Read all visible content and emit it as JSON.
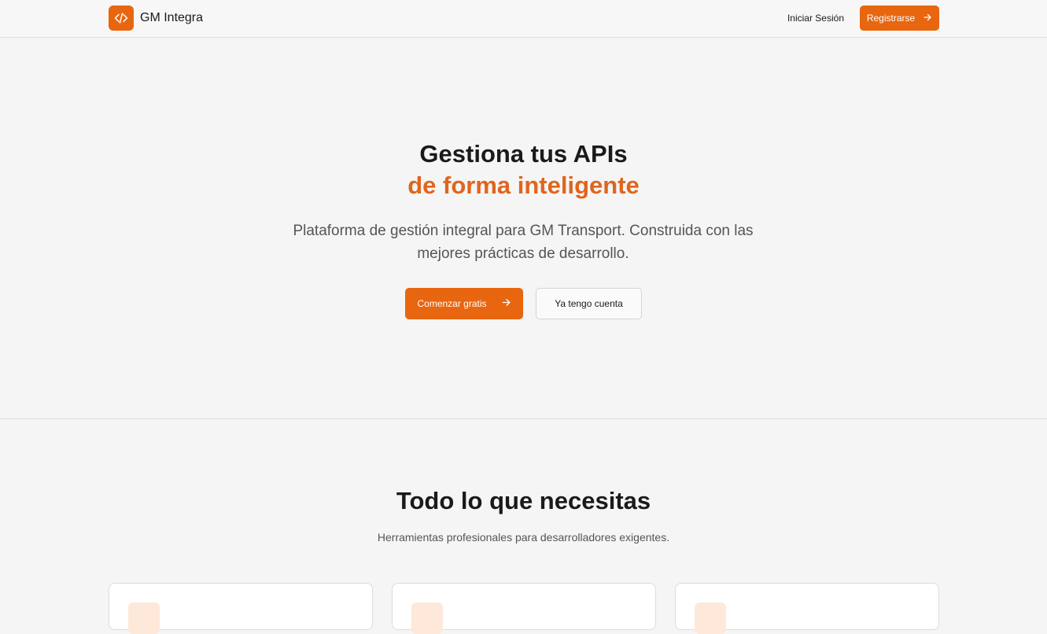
{
  "header": {
    "brand_name": "GM Integra",
    "login_label": "Iniciar Sesión",
    "register_label": "Registrarse"
  },
  "hero": {
    "title_line1": "Gestiona tus APIs",
    "title_line2": "de forma inteligente",
    "subtitle": "Plataforma de gestión integral para GM Transport. Construida con las mejores prácticas de desarrollo.",
    "primary_cta": "Comenzar gratis",
    "secondary_cta": "Ya tengo cuenta"
  },
  "features": {
    "title": "Todo lo que necesitas",
    "subtitle": "Herramientas profesionales para desarrolladores exigentes."
  },
  "colors": {
    "accent": "#e8660f",
    "background": "#f5f5f5"
  },
  "icons": {
    "logo": "code-icon",
    "arrow": "arrow-right-icon"
  }
}
